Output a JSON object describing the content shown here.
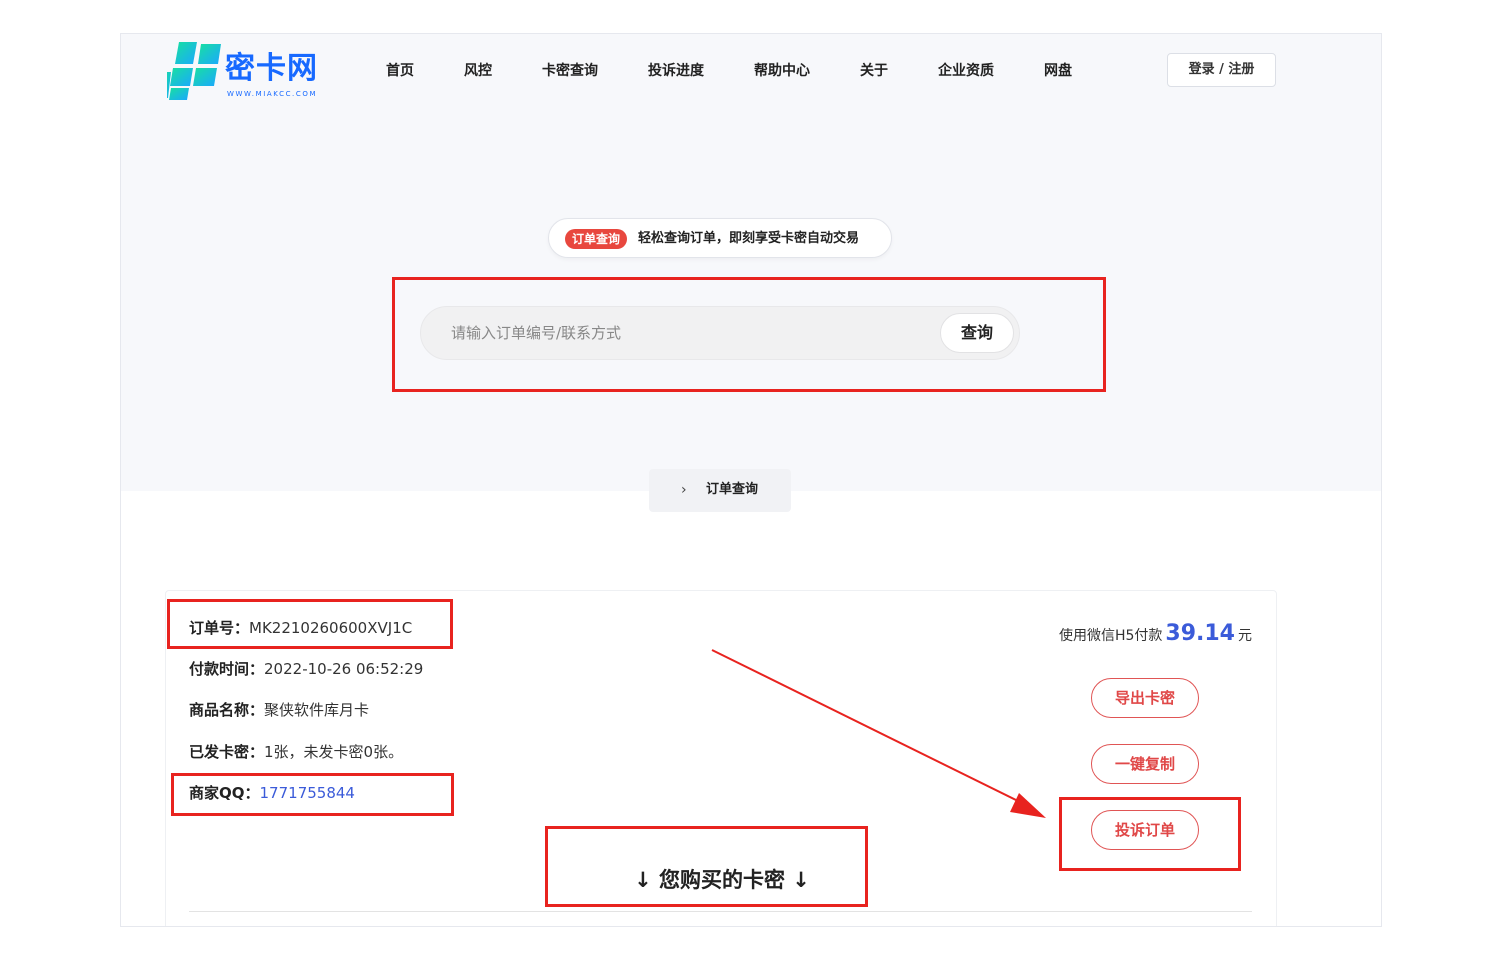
{
  "header": {
    "logo_text": "密卡网",
    "logo_sub": "WWW.MIAKCC.COM",
    "nav": [
      "首页",
      "风控",
      "卡密查询",
      "投诉进度",
      "帮助中心",
      "关于",
      "企业资质",
      "网盘"
    ],
    "login_label": "登录 / 注册"
  },
  "promo": {
    "badge": "订单查询",
    "text": "轻松查询订单，即刻享受卡密自动交易"
  },
  "search": {
    "placeholder": "请输入订单编号/联系方式",
    "button": "查询"
  },
  "breadcrumb": {
    "arrow": "›",
    "label": "订单查询"
  },
  "order": {
    "order_no_label": "订单号：",
    "order_no": "MK2210260600XVJ1C",
    "pay_time_label": "付款时间：",
    "pay_time": "2022-10-26 06:52:29",
    "product_label": "商品名称：",
    "product": "聚侠软件库月卡",
    "sent_label": "已发卡密：",
    "sent": "1张，未发卡密0张。",
    "qq_label": "商家QQ：",
    "qq": "1771755844",
    "pay_prefix": "使用微信H5付款",
    "amount": "39.14",
    "currency": "元",
    "btn_export": "导出卡密",
    "btn_copy": "一键复制",
    "btn_complain": "投诉订单",
    "cards_title": "↓ 您购买的卡密 ↓"
  },
  "colors": {
    "brand": "#1769ff",
    "logo_green": "#2ed3a5",
    "badge_red": "#e8473e",
    "link_blue": "#3b5bd9",
    "button_red": "#e04848",
    "annotation_red": "#e8231f"
  }
}
